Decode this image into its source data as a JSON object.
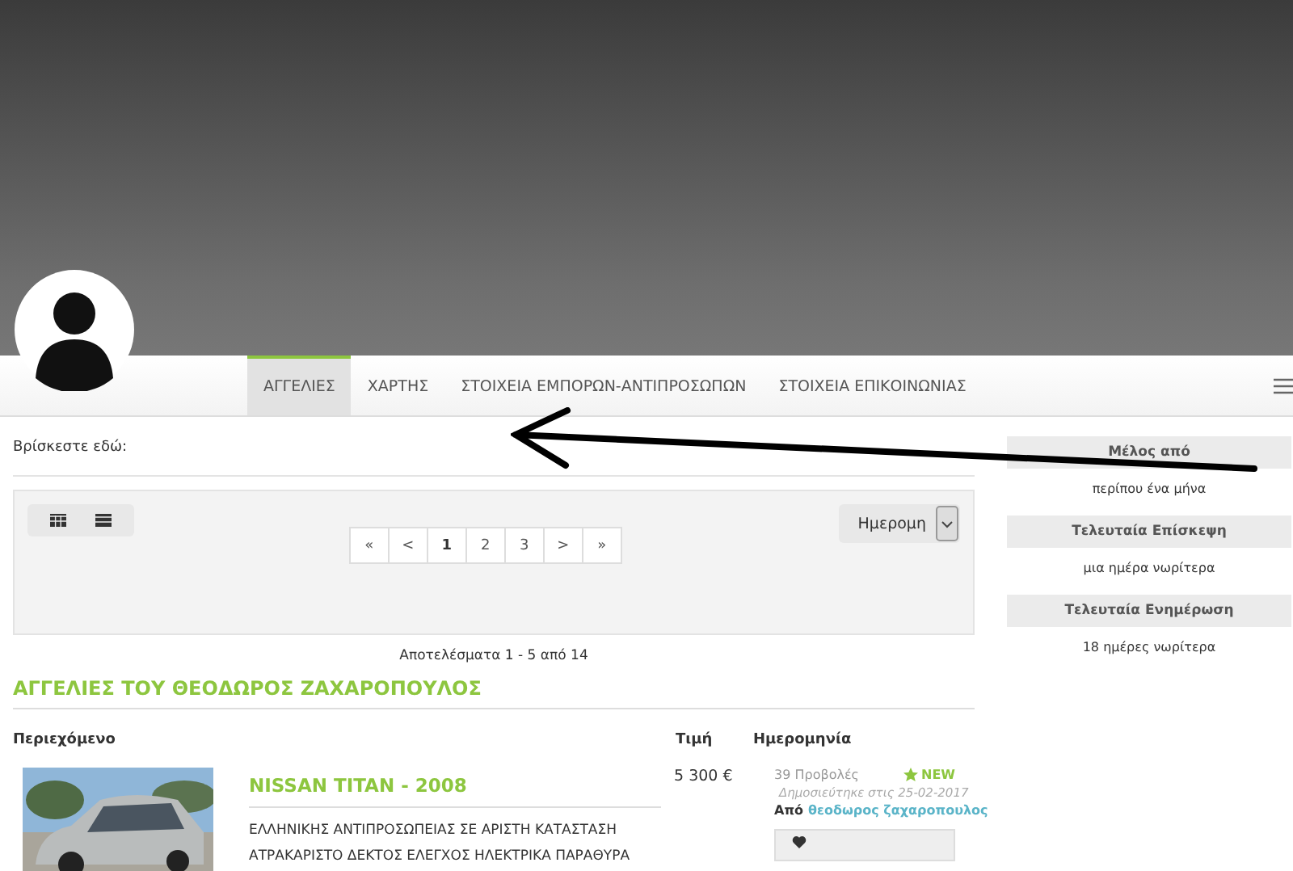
{
  "tabs": [
    {
      "label": "ΑΓΓΕΛΙΕΣ",
      "selected": true
    },
    {
      "label": "ΧΑΡΤΗΣ",
      "selected": false
    },
    {
      "label": "ΣΤΟΙΧΕΙΑ ΕΜΠΟΡΩΝ-ΑΝΤΙΠΡΟΣΩΠΩΝ",
      "selected": false
    },
    {
      "label": "ΣΤΟΙΧΕΙΑ ΕΠΙΚΟΙΝΩΝΙΑΣ",
      "selected": false
    }
  ],
  "breadcrumb": "Βρίσκεστε εδώ:",
  "pagination": [
    {
      "label": "«",
      "selected": false
    },
    {
      "label": "<",
      "selected": false
    },
    {
      "label": "1",
      "selected": true
    },
    {
      "label": "2",
      "selected": false
    },
    {
      "label": "3",
      "selected": false
    },
    {
      "label": ">",
      "selected": false
    },
    {
      "label": "»",
      "selected": false
    }
  ],
  "sort": {
    "value": "Ημερομη"
  },
  "results": "Αποτελέσματα 1 - 5 από 14",
  "section_title": "ΑΓΓΕΛΙΕΣ ΤΟΥ ΘΕΟΔΩΡΟΣ ΖΑΧΑΡΟΠΟΥΛΟΣ",
  "table": {
    "columns": [
      "Περιεχόμενο",
      "Τιμή",
      "Ημερομηνία"
    ],
    "rows": [
      {
        "title": "NISSAN TITAN - 2008",
        "description": "ΕΛΛΗΝΙΚΗΣ ΑΝΤΙΠΡΟΣΩΠΕΙΑΣ ΣΕ ΑΡΙΣΤΗ ΚΑΤΑΣΤΑΣΗ ΑΤΡΑΚΑΡΙΣΤΟ ΔΕΚΤΟΣ ΕΛΕΓΧΟΣ ΗΛΕΚΤΡΙΚΑ ΠΑΡΑΘΥΡΑ",
        "price": "5 300 €",
        "views": "39 Προβολές",
        "badge": "NEW",
        "published": "Δημοσιεύτηκε στις 25-02-2017",
        "by_label": "Από",
        "author": "θεοδωρος ζαχαροπουλος"
      }
    ]
  },
  "sidebar": [
    {
      "heading": "Μέλος από",
      "value": "περίπου ένα μήνα"
    },
    {
      "heading": "Τελευταία Επίσκεψη",
      "value": "μια ημέρα νωρίτερα"
    },
    {
      "heading": "Τελευταία Ενημέρωση",
      "value": "18 ημέρες νωρίτερα"
    }
  ]
}
